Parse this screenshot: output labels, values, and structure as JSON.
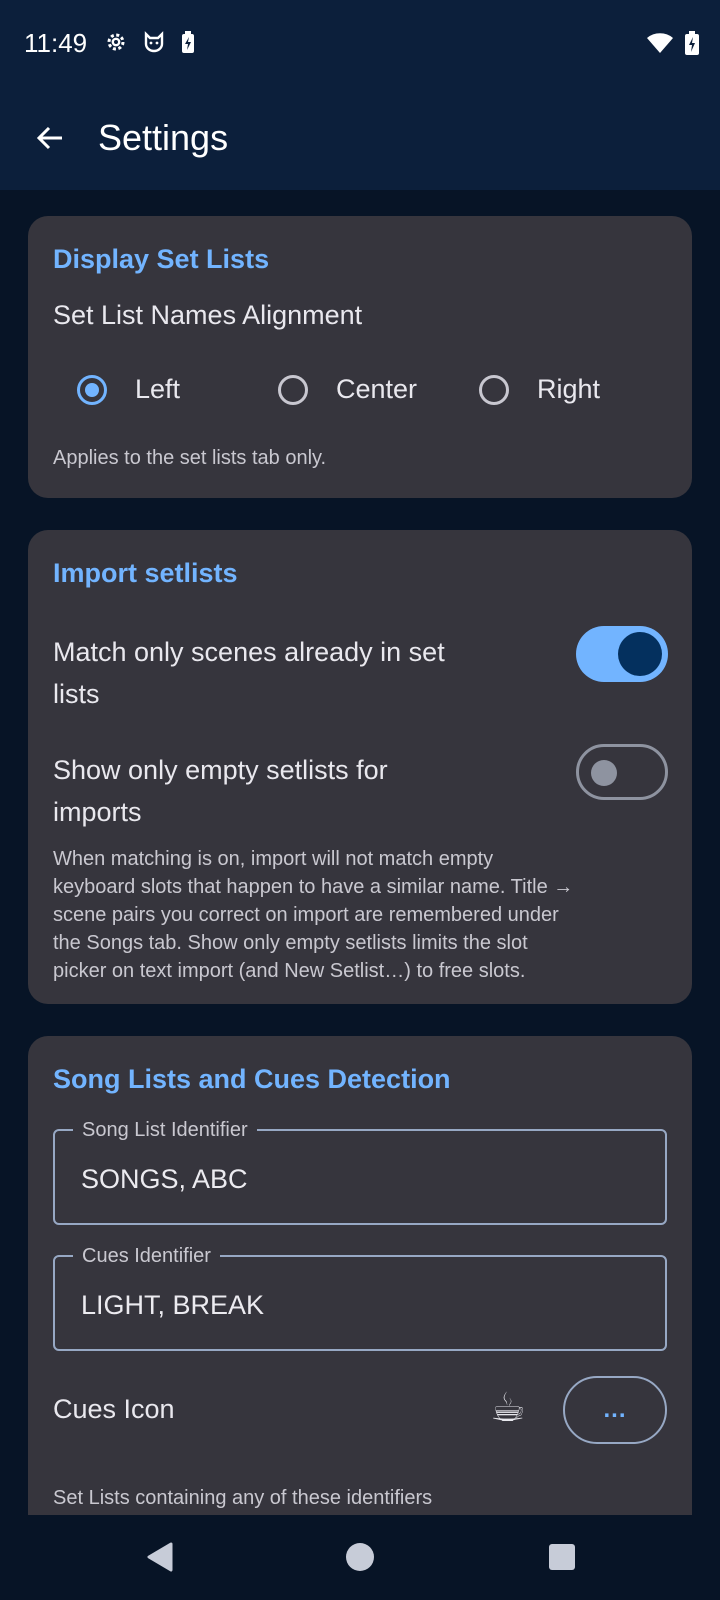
{
  "status_bar": {
    "time": "11:49",
    "left_icons": [
      "gear-icon",
      "cat-icon",
      "battery-saver-icon"
    ],
    "right_icons": [
      "wifi-icon",
      "battery-charging-icon"
    ]
  },
  "app_bar": {
    "title": "Settings",
    "back_icon": "arrow-back-icon"
  },
  "display_section": {
    "title": "Display Set Lists",
    "alignment_label": "Set List Names Alignment",
    "options": [
      "Left",
      "Center",
      "Right"
    ],
    "selected": "Left",
    "help": "Applies to the set lists tab only."
  },
  "import_section": {
    "title": "Import setlists",
    "match_label_line1": "Match only scenes already in set",
    "match_label_line2": "lists",
    "match_enabled": true,
    "empty_label_line1": "Show only empty setlists for",
    "empty_label_line2": "imports",
    "empty_enabled": false,
    "help_lines": [
      "When matching is on, import will not match empty",
      "keyboard slots that happen to have a similar name. Title →",
      "scene pairs you correct on import are remembered under",
      "the Songs tab. Show only empty setlists limits the slot",
      "picker on text import (and New Setlist…) to free slots."
    ]
  },
  "song_section": {
    "title": "Song Lists and Cues Detection",
    "song_field_label": "Song List Identifier",
    "song_field_value": "SONGS, ABC",
    "cues_field_label": "Cues Identifier",
    "cues_field_value": "LIGHT, BREAK",
    "cues_icon_label": "Cues Icon",
    "cues_icon_glyph": "☕",
    "more_button_label": "...",
    "help_partial": "Set Lists containing any of these identifiers"
  },
  "colors": {
    "accent": "#72b4ff",
    "card": "#36353d",
    "background": "#071426",
    "app_bar": "#0c1f3b"
  },
  "nav_bar": {
    "icons": [
      "back-triangle-icon",
      "home-circle-icon",
      "recents-square-icon"
    ]
  }
}
